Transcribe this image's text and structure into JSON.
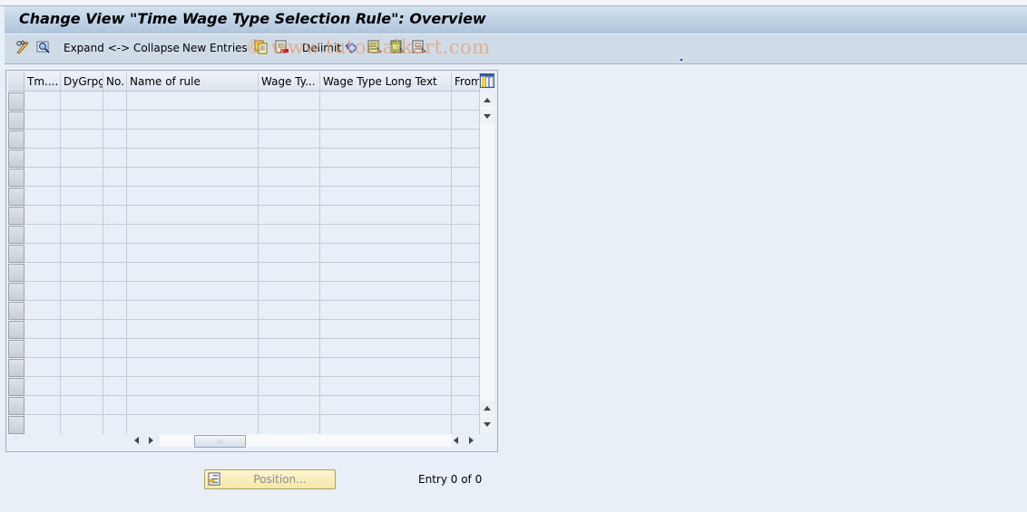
{
  "window": {
    "title": "Change View \"Time Wage Type Selection Rule\": Overview"
  },
  "toolbar": {
    "icons": [
      "display-change-icon",
      "find-icon"
    ],
    "expand_collapse_label": "Expand <-> Collapse",
    "new_entries_label": "New Entries",
    "copy_icon": "copy-as-icon",
    "delete_icon": "delete-icon",
    "delimit_label": "Delimit",
    "undo_icon": "undo-change-icon",
    "select_all_icon": "select-all-icon",
    "select_block_icon": "select-block-icon",
    "deselect_all_icon": "deselect-all-icon",
    "watermark": "© www.tutorialkart.com"
  },
  "table": {
    "columns": [
      {
        "label": "Tm...."
      },
      {
        "label": "DyGrpg"
      },
      {
        "label": "No."
      },
      {
        "label": "Name of rule"
      },
      {
        "label": "Wage Ty..."
      },
      {
        "label": "Wage Type Long Text"
      },
      {
        "label": "From"
      }
    ],
    "rows": [
      [
        "",
        "",
        "",
        "",
        "",
        "",
        ""
      ],
      [
        "",
        "",
        "",
        "",
        "",
        "",
        ""
      ],
      [
        "",
        "",
        "",
        "",
        "",
        "",
        ""
      ],
      [
        "",
        "",
        "",
        "",
        "",
        "",
        ""
      ],
      [
        "",
        "",
        "",
        "",
        "",
        "",
        ""
      ],
      [
        "",
        "",
        "",
        "",
        "",
        "",
        ""
      ],
      [
        "",
        "",
        "",
        "",
        "",
        "",
        ""
      ],
      [
        "",
        "",
        "",
        "",
        "",
        "",
        ""
      ],
      [
        "",
        "",
        "",
        "",
        "",
        "",
        ""
      ],
      [
        "",
        "",
        "",
        "",
        "",
        "",
        ""
      ],
      [
        "",
        "",
        "",
        "",
        "",
        "",
        ""
      ],
      [
        "",
        "",
        "",
        "",
        "",
        "",
        ""
      ],
      [
        "",
        "",
        "",
        "",
        "",
        "",
        ""
      ],
      [
        "",
        "",
        "",
        "",
        "",
        "",
        ""
      ],
      [
        "",
        "",
        "",
        "",
        "",
        "",
        ""
      ],
      [
        "",
        "",
        "",
        "",
        "",
        "",
        ""
      ],
      [
        "",
        "",
        "",
        "",
        "",
        "",
        ""
      ],
      [
        "",
        "",
        "",
        "",
        "",
        "",
        ""
      ]
    ],
    "hscroll_thumb_label": ":::"
  },
  "footer": {
    "position_button_label": "Position...",
    "entry_text": "Entry 0 of 0"
  },
  "colors": {
    "title_bar_top": "#d2e1ee",
    "title_bar_bottom": "#afc5dc",
    "toolbar_bg": "#cfdce8",
    "background": "#e9eff6",
    "position_button": "#f5e7a8"
  }
}
